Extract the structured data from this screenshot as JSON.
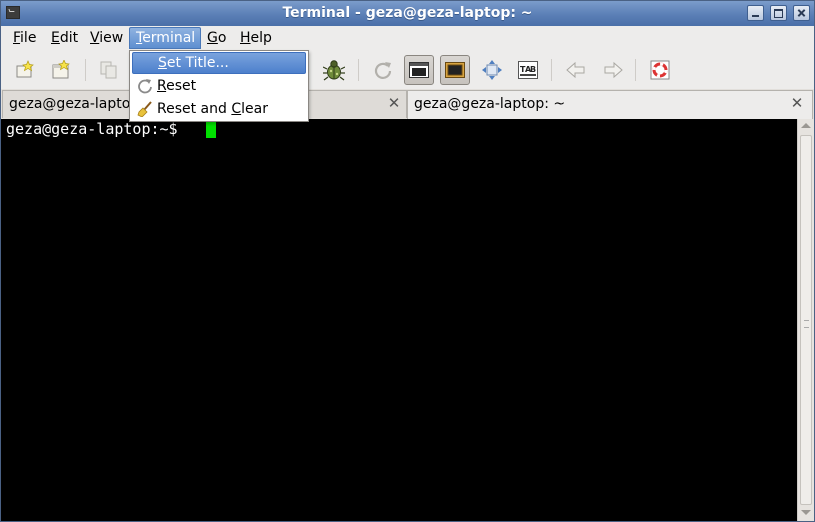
{
  "window": {
    "title": "Terminal - geza@geza-laptop: ~"
  },
  "menubar": {
    "items": [
      {
        "label": "File",
        "mnemonic": "F",
        "rest": "ile"
      },
      {
        "label": "Edit",
        "mnemonic": "E",
        "rest": "dit"
      },
      {
        "label": "View",
        "mnemonic": "V",
        "rest": "iew"
      },
      {
        "label": "Terminal",
        "mnemonic": "T",
        "rest": "erminal",
        "open": true
      },
      {
        "label": "Go",
        "mnemonic": "G",
        "rest": "o"
      },
      {
        "label": "Help",
        "mnemonic": "H",
        "rest": "elp"
      }
    ]
  },
  "terminal_menu": {
    "items": [
      {
        "label": "Set Title...",
        "mnemonic": "S",
        "rest": "et Title...",
        "icon": "none",
        "highlighted": true
      },
      {
        "label": "Reset",
        "mnemonic": "R",
        "rest": "eset",
        "icon": "reset-icon"
      },
      {
        "label": "Reset and Clear",
        "pre": "Reset and ",
        "mnemonic": "C",
        "rest": "lear",
        "icon": "broom-icon"
      }
    ]
  },
  "toolbar": {
    "buttons": [
      {
        "name": "new-tab-button",
        "icon": "new-tab-icon"
      },
      {
        "name": "new-window-button",
        "icon": "new-window-icon"
      },
      {
        "name": "copy-button",
        "icon": "copy-icon"
      },
      {
        "name": "debug-button",
        "icon": "bug-icon"
      },
      {
        "name": "refresh-button",
        "icon": "refresh-icon"
      },
      {
        "name": "toggle-menubar-button",
        "icon": "window-icon",
        "pressed": true
      },
      {
        "name": "toggle-borders-button",
        "icon": "frame-icon",
        "pressed": true
      },
      {
        "name": "fullscreen-button",
        "icon": "fullscreen-icon"
      },
      {
        "name": "character-encoding-button",
        "icon": "charset-icon"
      },
      {
        "name": "previous-tab-button",
        "icon": "arrow-left-icon"
      },
      {
        "name": "next-tab-button",
        "icon": "arrow-right-icon"
      },
      {
        "name": "help-button",
        "icon": "lifebuoy-icon"
      }
    ]
  },
  "tabs": [
    {
      "label": "geza@geza-laptop: ~",
      "active": false
    },
    {
      "label": "geza@geza-laptop: ~",
      "active": true
    }
  ],
  "terminal": {
    "prompt": "geza@geza-laptop:~$ ",
    "cursor_color": "#00e000",
    "background": "#000000",
    "foreground": "#ffffff"
  },
  "colors": {
    "titlebar": "#5b7fb6",
    "menu_highlight": "#4d80cc"
  }
}
